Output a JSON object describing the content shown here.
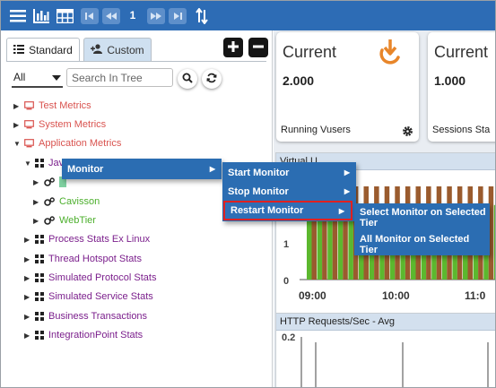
{
  "toolbar": {
    "icons": [
      "menu-icon",
      "bar-chart-icon",
      "grid-icon",
      "first-page-icon",
      "prev-page-icon",
      "next-page-icon",
      "last-page-icon",
      "sort-icon"
    ],
    "page": "1",
    "bg_color": "#2d6cb5"
  },
  "left_panel": {
    "tabs": {
      "standard": "Standard",
      "custom": "Custom"
    },
    "filter": {
      "value": "All"
    },
    "search": {
      "placeholder": "Search In Tree"
    },
    "tree": {
      "test_metrics": "Test Metrics",
      "system_metrics": "System Metrics",
      "application_metrics": "Application Metrics",
      "java_partial": "Jav",
      "cavisson": "Cavisson",
      "webtier": "WebTier",
      "process_stats": "Process Stats Ex Linux",
      "thread_hotspot": "Thread Hotspot Stats",
      "simulated_protocol": "Simulated Protocol Stats",
      "simulated_service": "Simulated Service Stats",
      "business_transactions": "Business Transactions",
      "integration_point": "IntegrationPoint Stats"
    },
    "colors": {
      "red_group": "#d9534f",
      "green_item": "#4caf2c",
      "purple_item": "#7b1f8c"
    }
  },
  "dashboard": {
    "cards": [
      {
        "title": "Current",
        "value": "2.000",
        "footer": "Running Vusers"
      },
      {
        "title": "Current",
        "value": "1.000",
        "footer": "Sessions Sta"
      }
    ],
    "chart1": {
      "title": "Virtual U",
      "y_ticks": [
        "1",
        "0"
      ],
      "x_ticks": [
        "09:00",
        "10:00",
        "11:0"
      ]
    },
    "chart2": {
      "title": "HTTP Requests/Sec - Avg",
      "y_ticks": [
        "0.2"
      ]
    },
    "accent": "#e8862a"
  },
  "chart_data": {
    "type": "bar",
    "title": "",
    "xlabel": "",
    "ylabel": "",
    "x_ticks": [
      "09:00",
      "10:00",
      "11:0"
    ],
    "ylim": [
      0,
      2
    ],
    "series": [
      {
        "color": "#5cb82e",
        "values": [
          1.6,
          1.6,
          1.6,
          1.6,
          1.6,
          1.6,
          1.6,
          1.6,
          1.6,
          1.6,
          1.6,
          1.6,
          1.6,
          1.6,
          1.6,
          1.6,
          1.6,
          1.6,
          1.6,
          1.6
        ]
      },
      {
        "color": "#9a5b2e",
        "values": [
          2,
          2,
          2,
          2,
          2,
          2,
          2,
          2,
          2,
          2,
          2,
          2,
          2,
          2,
          2,
          2,
          2,
          2,
          2,
          2
        ]
      }
    ]
  },
  "context_menu": {
    "level1": {
      "monitor": "Monitor"
    },
    "level2": {
      "start": "Start Monitor",
      "stop": "Stop Monitor",
      "restart": "Restart Monitor"
    },
    "level3": {
      "select": "Select Monitor on Selected Tier",
      "all": "All Monitor on Selected Tier"
    },
    "bg_color": "#2b6db2",
    "highlight_border": "#e02020"
  }
}
